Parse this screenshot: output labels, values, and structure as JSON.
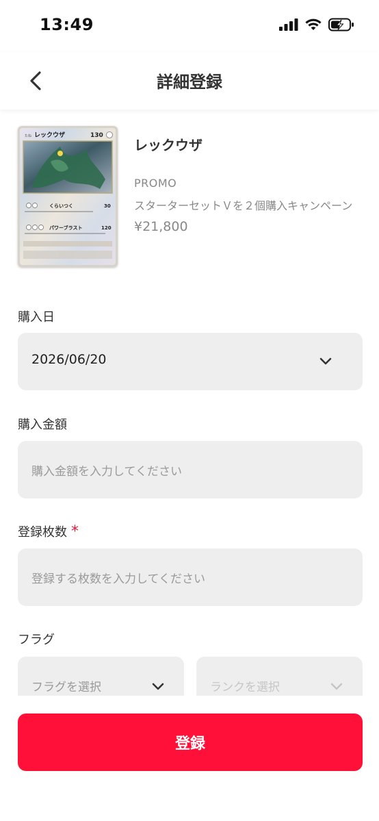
{
  "status_bar": {
    "time": "13:49"
  },
  "nav": {
    "title": "詳細登録"
  },
  "card": {
    "image_name": "レックウザ",
    "image_hp": "130",
    "image_attack1_name": "くらいつく",
    "image_attack1_damage": "30",
    "image_attack2_name": "パワーブラスト",
    "image_attack2_damage": "120",
    "name": "レックウザ",
    "set": "PROMO",
    "description": "スターターセットＶを２個購入キャンペーン",
    "price": "¥21,800"
  },
  "purchase_date": {
    "label": "購入日",
    "value": "2026/06/20"
  },
  "purchase_price": {
    "label": "購入金額",
    "placeholder": "購入金額を入力してください"
  },
  "count": {
    "label": "登録枚数",
    "required_mark": "*",
    "placeholder": "登録する枚数を入力してください"
  },
  "flag": {
    "label": "フラグ",
    "flag_placeholder": "フラグを選択",
    "rank_placeholder": "ランクを選択"
  },
  "register_button": {
    "label": "登録"
  },
  "colors": {
    "accent": "#ff1038",
    "field_bg": "#eeeeee",
    "required": "#e8173a"
  }
}
